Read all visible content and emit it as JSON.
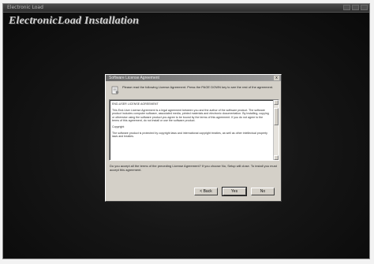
{
  "window": {
    "title": "Electronic Load"
  },
  "app": {
    "heading": "ElectronicLoad Installation"
  },
  "dialog": {
    "title": "Software License Agreement",
    "close_glyph": "x",
    "instructions": "Please read the following License Agreement. Press the PAGE DOWN key to see the rest of the agreement.",
    "license_paragraphs": [
      "END-USER LICENSE AGREEMENT",
      "This End-User License Agreement is a legal agreement between you and the author of the software product. The software product includes computer software, associated media, printed materials and electronic documentation. By installing, copying or otherwise using the software product you agree to be bound by the terms of this agreement. If you do not agree to the terms of this agreement, do not install or use the software product.",
      "Copyright",
      "The software product is protected by copyright laws and international copyright treaties, as well as other intellectual property laws and treaties."
    ],
    "question": "Do you accept all the terms of the preceding License Agreement? If you choose No, Setup will close. To install you must accept this agreement.",
    "buttons": {
      "back": "< Back",
      "yes": "Yes",
      "no": "No"
    }
  }
}
